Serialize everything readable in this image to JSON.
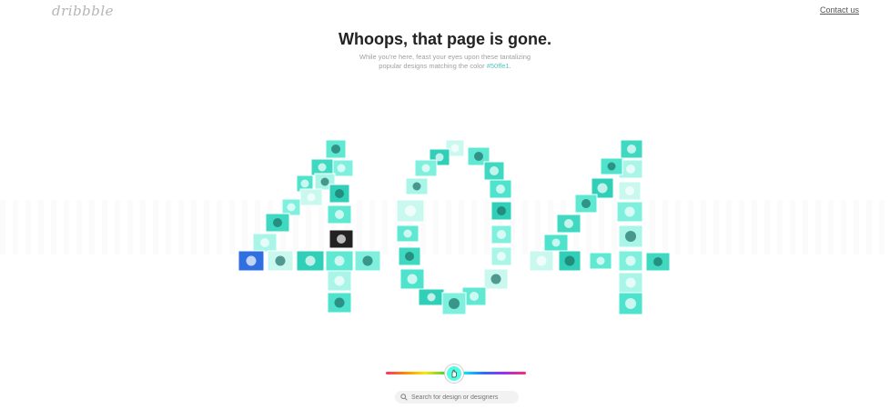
{
  "header": {
    "logo": "dribbble",
    "contact_label": "Contact us"
  },
  "message": {
    "title": "Whoops, that page is gone.",
    "subtitle_line1": "While you're here, feast your eyes upon these tantalizing",
    "subtitle_line2_prefix": "popular designs matching the color ",
    "color_hex": "#50ffe1",
    "subtitle_line2_suffix": "."
  },
  "colors": {
    "accent": "#50ffe1",
    "hex_text": "#50c7c0",
    "tile_base": "#5fe8d2"
  },
  "digits": [
    "4",
    "0",
    "4"
  ],
  "color_picker": {
    "selected_color": "#50ffe1",
    "handle_icon": "hand-icon"
  },
  "search": {
    "placeholder": "Search for design or designers",
    "icon": "search-icon"
  }
}
